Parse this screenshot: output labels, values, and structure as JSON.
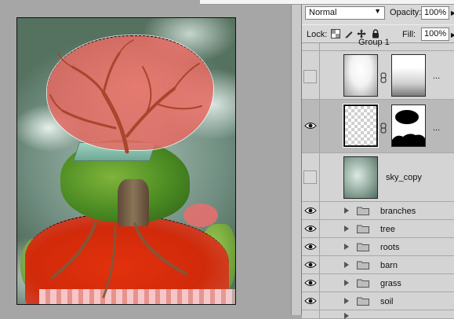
{
  "layers_panel": {
    "blend_mode": "Normal",
    "opacity_label": "Opacity:",
    "opacity_value": "100%",
    "lock_label": "Lock:",
    "fill_label": "Fill:",
    "fill_value": "100%",
    "group_name": "Group 1",
    "layers": [
      {
        "name": "",
        "visible": false,
        "type": "adjustment-with-mask"
      },
      {
        "name": "",
        "visible": true,
        "type": "layer-with-mask",
        "selected": true
      },
      {
        "name": "sky_copy",
        "visible": false,
        "type": "image"
      },
      {
        "name": "branches",
        "visible": true,
        "type": "group"
      },
      {
        "name": "tree",
        "visible": true,
        "type": "group"
      },
      {
        "name": "roots",
        "visible": true,
        "type": "group"
      },
      {
        "name": "barn",
        "visible": true,
        "type": "group"
      },
      {
        "name": "grass",
        "visible": true,
        "type": "group"
      },
      {
        "name": "soil",
        "visible": true,
        "type": "group"
      }
    ]
  },
  "colors": {
    "panel_bg": "#d4d4d4",
    "selected_row": "#b9b9b9",
    "quick_mask": "#e2310d"
  }
}
